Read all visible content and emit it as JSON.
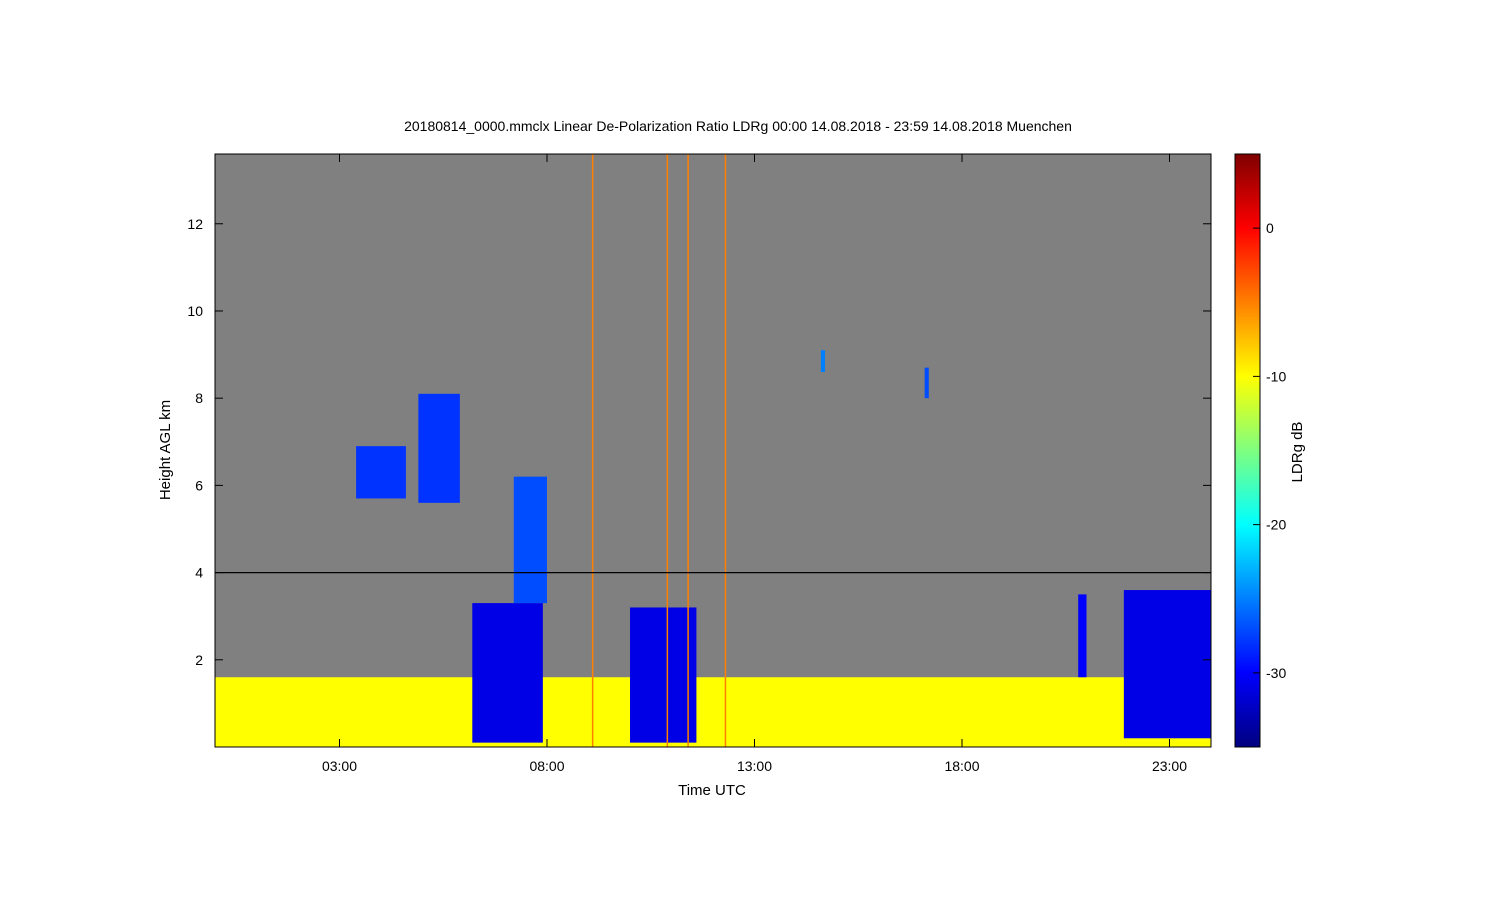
{
  "chart_data": {
    "type": "heatmap",
    "title": "20180814_0000.mmclx Linear De-Polarization Ratio LDRg   00:00 14.08.2018 - 23:59 14.08.2018 Muenchen",
    "xlabel": "Time UTC",
    "ylabel": "Height AGL km",
    "colorbar_label": "LDRg dB",
    "xlim": [
      0.0,
      24.0
    ],
    "ylim": [
      0.0,
      13.6
    ],
    "clim": [
      -35,
      5
    ],
    "x_ticks": [
      {
        "value": 3,
        "label": "03:00"
      },
      {
        "value": 8,
        "label": "08:00"
      },
      {
        "value": 13,
        "label": "13:00"
      },
      {
        "value": 18,
        "label": "18:00"
      },
      {
        "value": 23,
        "label": "23:00"
      }
    ],
    "y_ticks": [
      {
        "value": 2,
        "label": "2"
      },
      {
        "value": 4,
        "label": "4"
      },
      {
        "value": 6,
        "label": "6"
      },
      {
        "value": 8,
        "label": "8"
      },
      {
        "value": 10,
        "label": "10"
      },
      {
        "value": 12,
        "label": "12"
      }
    ],
    "colorbar_ticks": [
      {
        "value": 0,
        "label": "0"
      },
      {
        "value": -10,
        "label": "-10"
      },
      {
        "value": -20,
        "label": "-20"
      },
      {
        "value": -30,
        "label": "-30"
      }
    ],
    "background_color": "#808080",
    "colormap": "jet",
    "reference_line_height": 4.0,
    "echo_regions": [
      {
        "t0": 0.0,
        "t1": 24.0,
        "h0": 0.0,
        "h1": 1.6,
        "ldr": -10
      },
      {
        "t0": 4.9,
        "t1": 5.9,
        "h0": 5.6,
        "h1": 8.1,
        "ldr": -28
      },
      {
        "t0": 3.4,
        "t1": 4.6,
        "h0": 5.7,
        "h1": 6.9,
        "ldr": -28
      },
      {
        "t0": 6.2,
        "t1": 7.9,
        "h0": 0.1,
        "h1": 3.3,
        "ldr": -31
      },
      {
        "t0": 7.2,
        "t1": 8.0,
        "h0": 3.3,
        "h1": 6.2,
        "ldr": -27
      },
      {
        "t0": 10.0,
        "t1": 11.6,
        "h0": 0.1,
        "h1": 3.2,
        "ldr": -31
      },
      {
        "t0": 21.9,
        "t1": 24.0,
        "h0": 0.2,
        "h1": 3.6,
        "ldr": -31
      },
      {
        "t0": 20.8,
        "t1": 21.0,
        "h0": 1.6,
        "h1": 3.5,
        "ldr": -30
      },
      {
        "t0": 14.6,
        "t1": 14.7,
        "h0": 8.6,
        "h1": 9.1,
        "ldr": -25
      },
      {
        "t0": 17.1,
        "t1": 17.2,
        "h0": 8.0,
        "h1": 8.7,
        "ldr": -27
      }
    ],
    "spike_lines": [
      {
        "t": 9.1,
        "ldr": -5
      },
      {
        "t": 10.9,
        "ldr": -5
      },
      {
        "t": 11.4,
        "ldr": -5
      },
      {
        "t": 12.3,
        "ldr": -5
      }
    ]
  }
}
